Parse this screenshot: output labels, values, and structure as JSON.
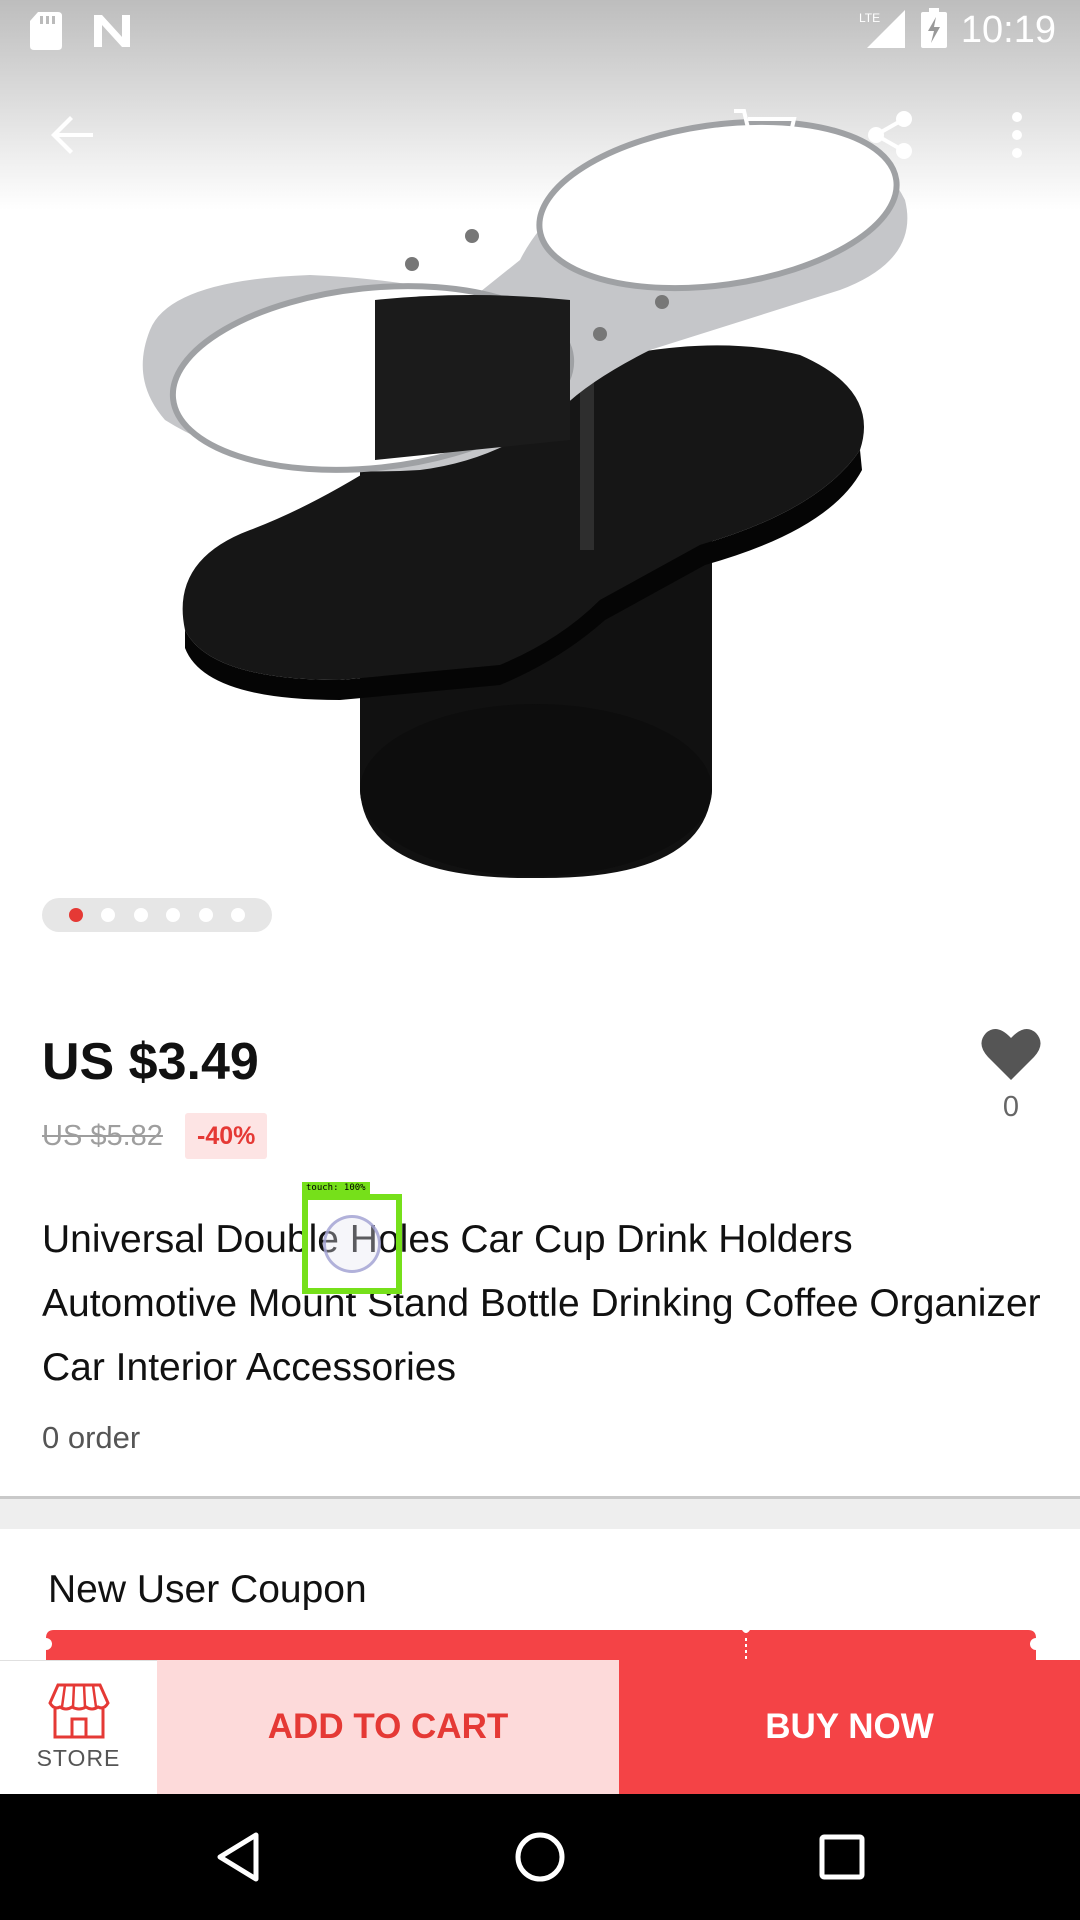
{
  "status_bar": {
    "time": "10:19",
    "network": "LTE",
    "icons": [
      "sd-card-icon",
      "n-notification-icon",
      "lte-signal-icon",
      "battery-charging-icon"
    ]
  },
  "toolbar": {
    "icons": [
      "back-arrow-icon",
      "cart-icon",
      "share-icon",
      "more-vert-icon"
    ]
  },
  "gallery": {
    "image_count": 6,
    "active_index": 0
  },
  "product": {
    "price": "US $3.49",
    "original_price": "US $5.82",
    "discount": "-40%",
    "wishlist_count": "0",
    "title": "Universal Double Holes Car Cup Drink Holders Automotive Mount Stand Bottle Drinking Coffee Organizer Car Interior Accessories",
    "orders": "0 order"
  },
  "coupon": {
    "title": "New User Coupon"
  },
  "touch_overlay": {
    "label": "touch: 100%"
  },
  "actions": {
    "store_label": "STORE",
    "add_to_cart_label": "ADD TO CART",
    "buy_now_label": "BUY NOW"
  },
  "nav_bar": {
    "icons": [
      "nav-back-icon",
      "nav-home-icon",
      "nav-recents-icon"
    ]
  },
  "colors": {
    "accent": "#f44346",
    "price_red": "#e53935",
    "cart_bg": "#fddada"
  }
}
